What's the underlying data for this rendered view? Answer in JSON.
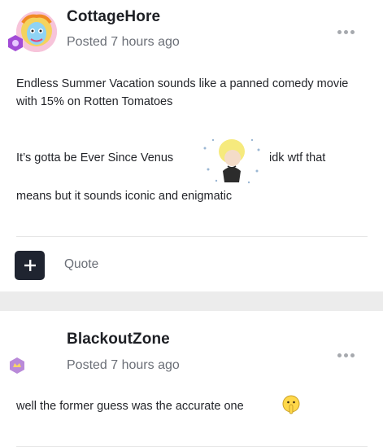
{
  "posts": [
    {
      "username": "CottageHore",
      "posted": "Posted 7 hours ago",
      "line1": "Endless Summer Vacation sounds like a panned comedy movie with 15% on Rotten Tomatoes",
      "line2_before": "It’s gotta be Ever Since Venus",
      "line2_after": "idk wtf that",
      "line3": "means but it sounds iconic and enigmatic",
      "quote_label": "Quote"
    },
    {
      "username": "BlackoutZone",
      "posted": "Posted 7 hours ago",
      "text": "well the former guess was the accurate one"
    }
  ],
  "icons": {
    "more": "more-options-icon",
    "add": "plus-icon",
    "rank": "rank-badge-icon",
    "sticker": "sticker",
    "emoji": "shushing-face-emoji"
  },
  "colors": {
    "dark_button": "#1f2430",
    "muted_text": "#6b6f77",
    "separator": "#ececec",
    "rank1": "#a24bd6",
    "rank2": "#b98ad9"
  }
}
